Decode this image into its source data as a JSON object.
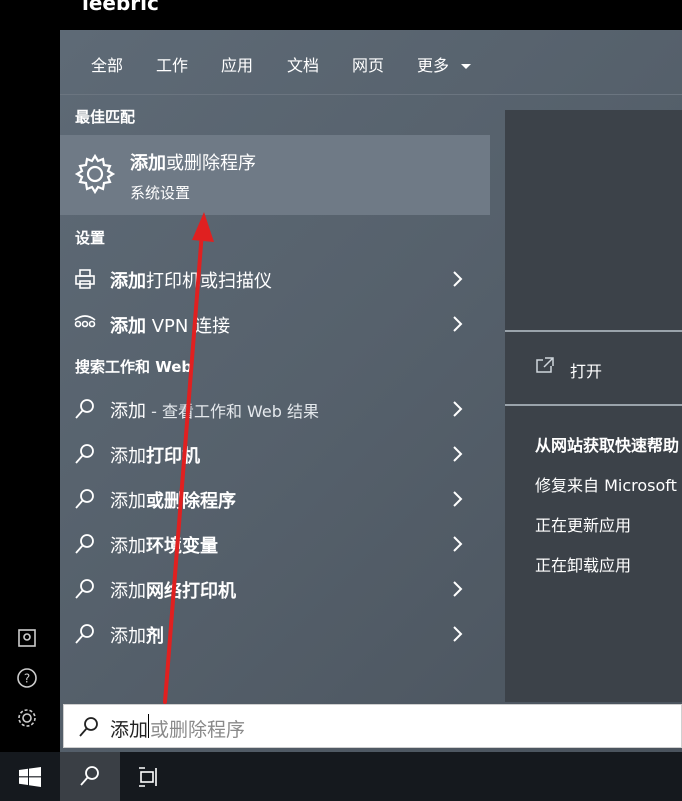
{
  "window": {
    "title": "leebric"
  },
  "tabs": [
    "全部",
    "工作",
    "应用",
    "文档",
    "网页",
    "更多"
  ],
  "best_match": {
    "header": "最佳匹配",
    "title_bold": "添加",
    "title_rest": "或删除程序",
    "subtitle": "系统设置",
    "icon": "gear-icon"
  },
  "settings": {
    "header": "设置",
    "items": [
      {
        "bold": "添加",
        "rest": "打印机或扫描仪",
        "icon": "printer-icon"
      },
      {
        "bold": "添加",
        "rest": " VPN 连接",
        "icon": "vpn-icon"
      }
    ]
  },
  "web": {
    "header": "搜索工作和 Web",
    "items": [
      {
        "plain": "添加",
        "bold": "",
        "note": " - 查看工作和 Web 结果"
      },
      {
        "plain": "添加",
        "bold": "打印机",
        "note": ""
      },
      {
        "plain": "添加",
        "bold": "或删除程序",
        "note": ""
      },
      {
        "plain": "添加",
        "bold": "环境变量",
        "note": ""
      },
      {
        "plain": "添加",
        "bold": "网络打印机",
        "note": ""
      },
      {
        "plain": "添加",
        "bold": "剂",
        "note": ""
      }
    ]
  },
  "preview": {
    "open_label": "打开",
    "help_title": "从网站获取快速帮助",
    "help_links": [
      "修复来自 Microsoft",
      "正在更新应用",
      "正在卸载应用"
    ]
  },
  "search": {
    "typed": "添加",
    "suggestion": "或删除程序"
  },
  "colors": {
    "panel": "#56616c",
    "selected": "#6f7a86",
    "annotation_arrow": "#e02020"
  }
}
